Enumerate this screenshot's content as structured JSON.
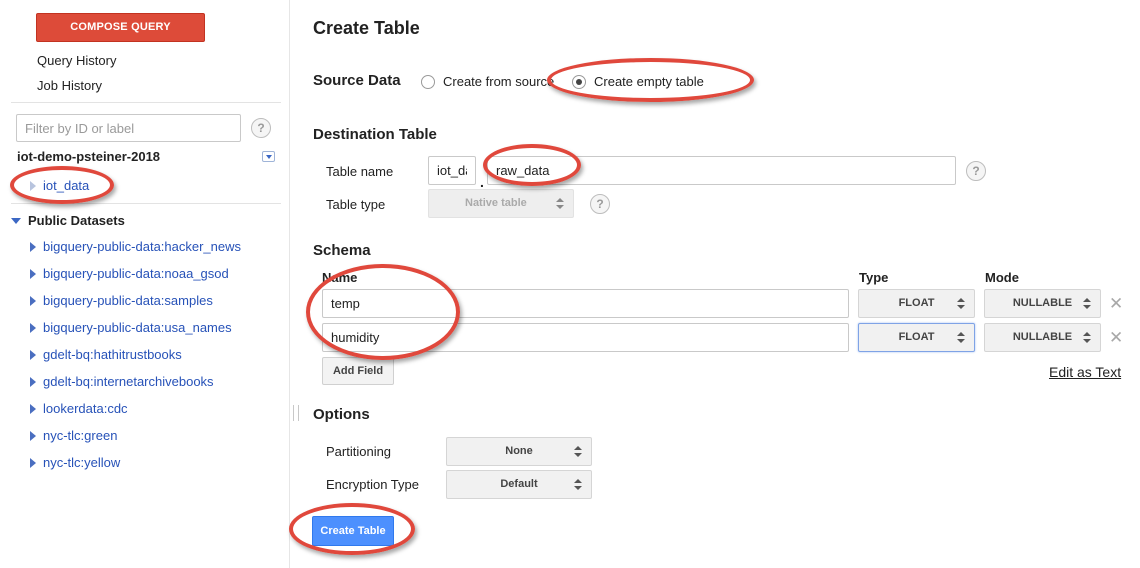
{
  "sidebar": {
    "compose_label": "COMPOSE QUERY",
    "query_history": "Query History",
    "job_history": "Job History",
    "filter_placeholder": "Filter by ID or label",
    "help_glyph": "?",
    "project": "iot-demo-psteiner-2018",
    "project_datasets": [
      "iot_data"
    ],
    "public_label": "Public Datasets",
    "public_datasets": [
      "bigquery-public-data:hacker_news",
      "bigquery-public-data:noaa_gsod",
      "bigquery-public-data:samples",
      "bigquery-public-data:usa_names",
      "gdelt-bq:hathitrustbooks",
      "gdelt-bq:internetarchivebooks",
      "lookerdata:cdc",
      "nyc-tlc:green",
      "nyc-tlc:yellow"
    ]
  },
  "main": {
    "title": "Create Table",
    "source": {
      "label": "Source Data",
      "option_from_source": "Create from source",
      "option_empty": "Create empty table",
      "selected": "Create empty table"
    },
    "destination": {
      "label": "Destination Table",
      "table_name_label": "Table name",
      "dataset_value": "iot_data",
      "separator": ".",
      "table_value": "raw_data",
      "table_type_label": "Table type",
      "table_type_value": "Native table",
      "help_glyph": "?"
    },
    "schema": {
      "label": "Schema",
      "col_name": "Name",
      "col_type": "Type",
      "col_mode": "Mode",
      "fields": [
        {
          "name": "temp",
          "type": "FLOAT",
          "mode": "NULLABLE"
        },
        {
          "name": "humidity",
          "type": "FLOAT",
          "mode": "NULLABLE"
        }
      ],
      "remove_glyph": "✕",
      "add_field_label": "Add Field",
      "edit_as_text_label": "Edit as Text"
    },
    "options": {
      "label": "Options",
      "partitioning_label": "Partitioning",
      "partitioning_value": "None",
      "encryption_label": "Encryption Type",
      "encryption_value": "Default"
    },
    "create_button_label": "Create Table"
  },
  "colors": {
    "compose": "#dd4b39",
    "primary": "#4d90fe",
    "link": "#2752b8",
    "annotation": "#e0483c"
  }
}
